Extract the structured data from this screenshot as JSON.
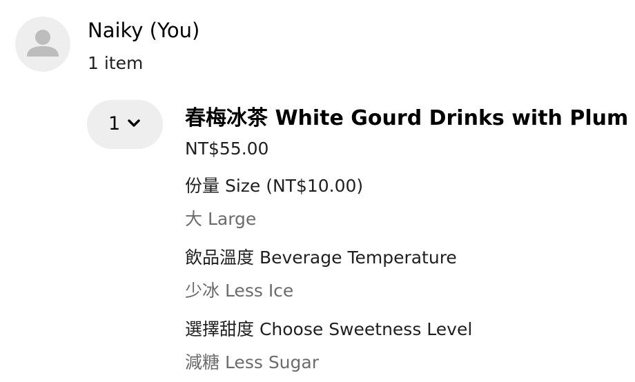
{
  "user": {
    "avatar_icon": "person-silhouette-icon",
    "name": "Naiky (You)",
    "item_count": "1 item"
  },
  "cart_item": {
    "quantity": "1",
    "quantity_icon": "chevron-down-icon",
    "title": "春梅冰茶 White Gourd Drinks with Plum",
    "price": "NT$55.00",
    "options": [
      {
        "label": "份量 Size (NT$10.00)",
        "value": "大 Large"
      },
      {
        "label": "飲品溫度 Beverage Temperature",
        "value": "少冰 Less Ice"
      },
      {
        "label": "選擇甜度 Choose Sweetness Level",
        "value": "減糖 Less Sugar"
      }
    ]
  },
  "colors": {
    "avatar_bg": "#eeeeee",
    "avatar_figure": "#bdbdbd",
    "stepper_bg": "#eeeeee",
    "primary_text": "#000000",
    "secondary_text": "#6b6b6b"
  }
}
